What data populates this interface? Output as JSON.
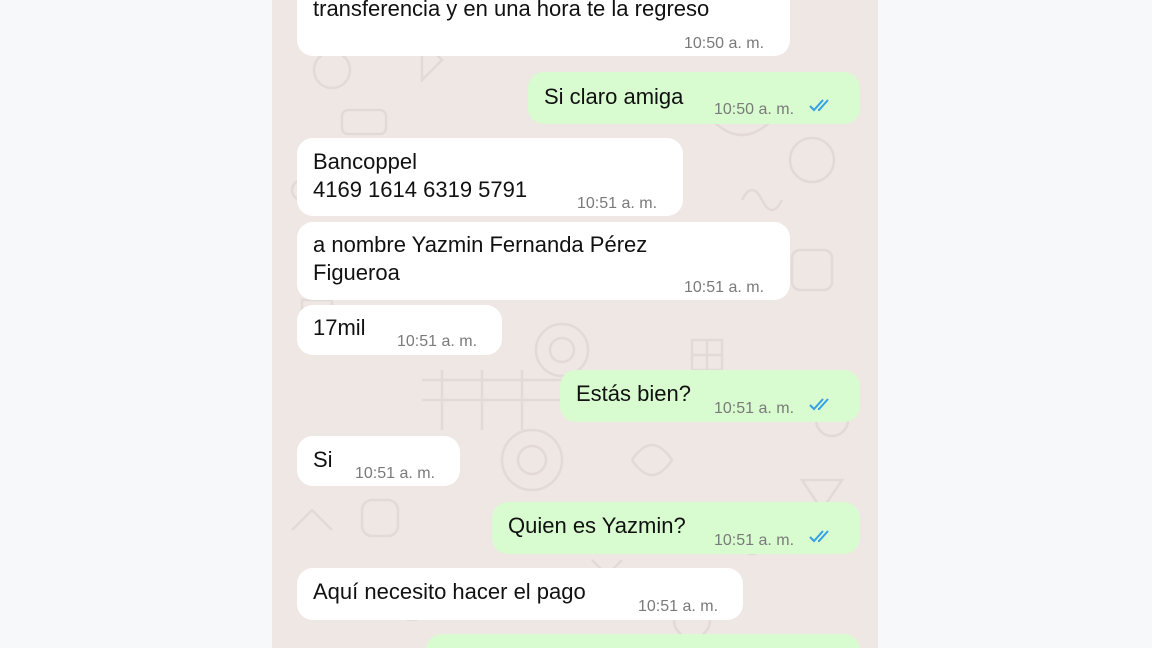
{
  "messages": [
    {
      "direction": "incoming",
      "text": "transferencia y en una hora te la regreso",
      "time": "10:50 a. m."
    },
    {
      "direction": "outgoing",
      "text": "Si claro amiga",
      "time": "10:50 a. m.",
      "read": true
    },
    {
      "direction": "incoming",
      "text": "Bancoppel\n4169 1614 6319 5791",
      "time": "10:51 a. m."
    },
    {
      "direction": "incoming",
      "text": "a nombre Yazmin Fernanda Pérez\nFigueroa",
      "time": "10:51 a. m."
    },
    {
      "direction": "incoming",
      "text": "17mil",
      "time": "10:51 a. m."
    },
    {
      "direction": "outgoing",
      "text": "Estás bien?",
      "time": "10:51 a. m.",
      "read": true
    },
    {
      "direction": "incoming",
      "text": "Si",
      "time": "10:51 a. m."
    },
    {
      "direction": "outgoing",
      "text": "Quien es Yazmin?",
      "time": "10:51 a. m.",
      "read": true
    },
    {
      "direction": "incoming",
      "text": "Aquí necesito hacer el pago",
      "time": "10:51 a. m."
    }
  ],
  "colors": {
    "incoming_bubble": "#ffffff",
    "outgoing_bubble": "#d8fccf",
    "chat_background": "#efe7e4",
    "read_tick": "#34a0e8",
    "timestamp": "#7a7a7a"
  },
  "icons": {
    "read_receipt": "double-check-icon"
  }
}
